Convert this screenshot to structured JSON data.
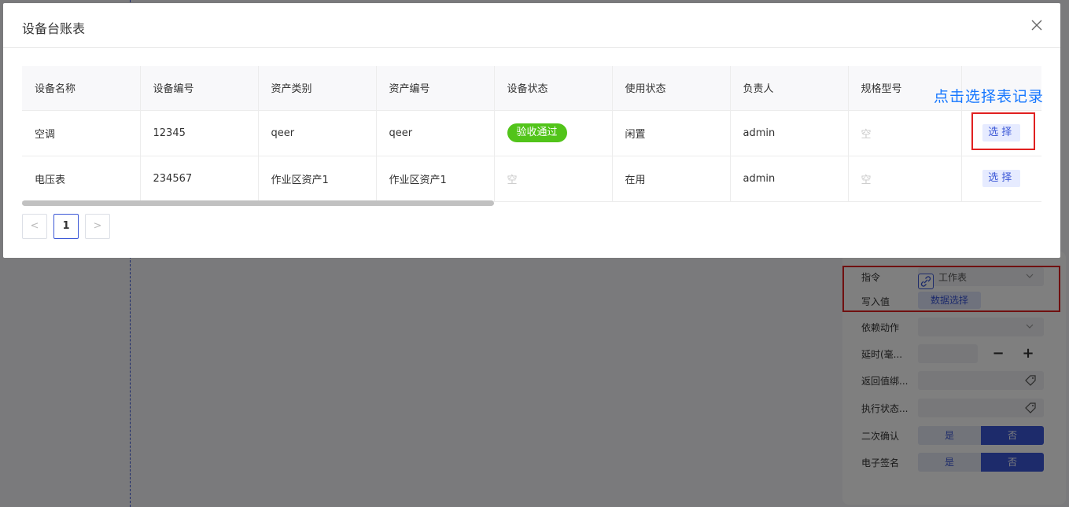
{
  "modal": {
    "title": "设备台账表",
    "columns": [
      "设备名称",
      "设备编号",
      "资产类别",
      "资产编号",
      "设备状态",
      "使用状态",
      "负责人",
      "规格型号",
      ""
    ],
    "rows": [
      {
        "name": "空调",
        "code": "12345",
        "category": "qeer",
        "asset_code": "qeer",
        "device_status": "验收通过",
        "use_status": "闲置",
        "owner": "admin",
        "spec": "空",
        "action": "选择"
      },
      {
        "name": "电压表",
        "code": "234567",
        "category": "作业区资产1",
        "asset_code": "作业区资产1",
        "device_status": "空",
        "use_status": "在用",
        "owner": "admin",
        "spec": "空",
        "action": "选择"
      }
    ],
    "pagination": {
      "prev": "<",
      "current": "1",
      "next": ">"
    }
  },
  "annotation": {
    "text": "点击选择表记录"
  },
  "side_panel": {
    "instruction_label": "指令",
    "instruction_value": "工作表",
    "write_value_label": "写入值",
    "data_select_button": "数据选择",
    "depend_action_label": "依赖动作",
    "delay_label": "延时(毫...",
    "return_bind_label": "返回值绑...",
    "exec_status_label": "执行状态...",
    "second_confirm_label": "二次确认",
    "e_sign_label": "电子签名",
    "yes": "是",
    "no": "否"
  },
  "colors": {
    "accent": "#3b57d6",
    "success": "#52c41a",
    "annotation_red": "#e02020",
    "annotation_blue": "#1677ff"
  }
}
